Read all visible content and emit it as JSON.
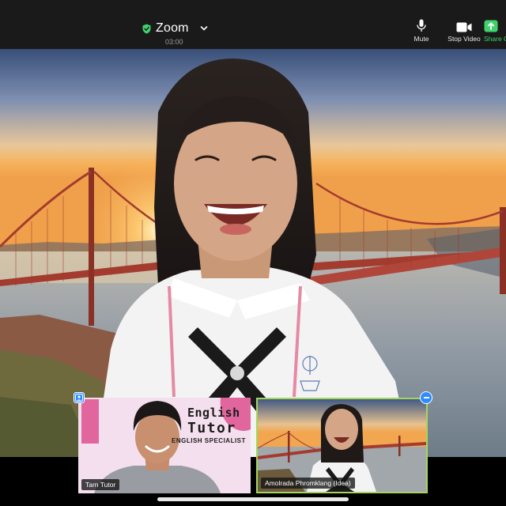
{
  "meeting": {
    "title": "Zoom",
    "timer": "03:00"
  },
  "toolbar": {
    "mute_label": "Mute",
    "stop_video_label": "Stop Video",
    "share_label": "Share C"
  },
  "participants": {
    "tutor": {
      "name": "Tarn Tutor",
      "background_title_line1": "English",
      "background_title_line2": "Tutor",
      "background_subtitle": "ENGLISH SPECIALIST"
    },
    "self": {
      "name": "Amolrada Phromklang (Idea)"
    }
  },
  "colors": {
    "toolbar_bg": "#1a1a1a",
    "secure_shield": "#3fd16b",
    "share_accent": "#3fd16b",
    "active_speaker_border": "#a4d65e",
    "control_blue": "#2d8cff",
    "tutor_bg_pink": "#f4dfee",
    "tutor_accent_pink": "#e0669d"
  },
  "icons": {
    "secure": "shield-check-icon",
    "mute": "microphone-icon",
    "video": "video-camera-icon",
    "share": "share-screen-icon",
    "pin": "person-pin-icon",
    "minimize": "minus-icon"
  }
}
